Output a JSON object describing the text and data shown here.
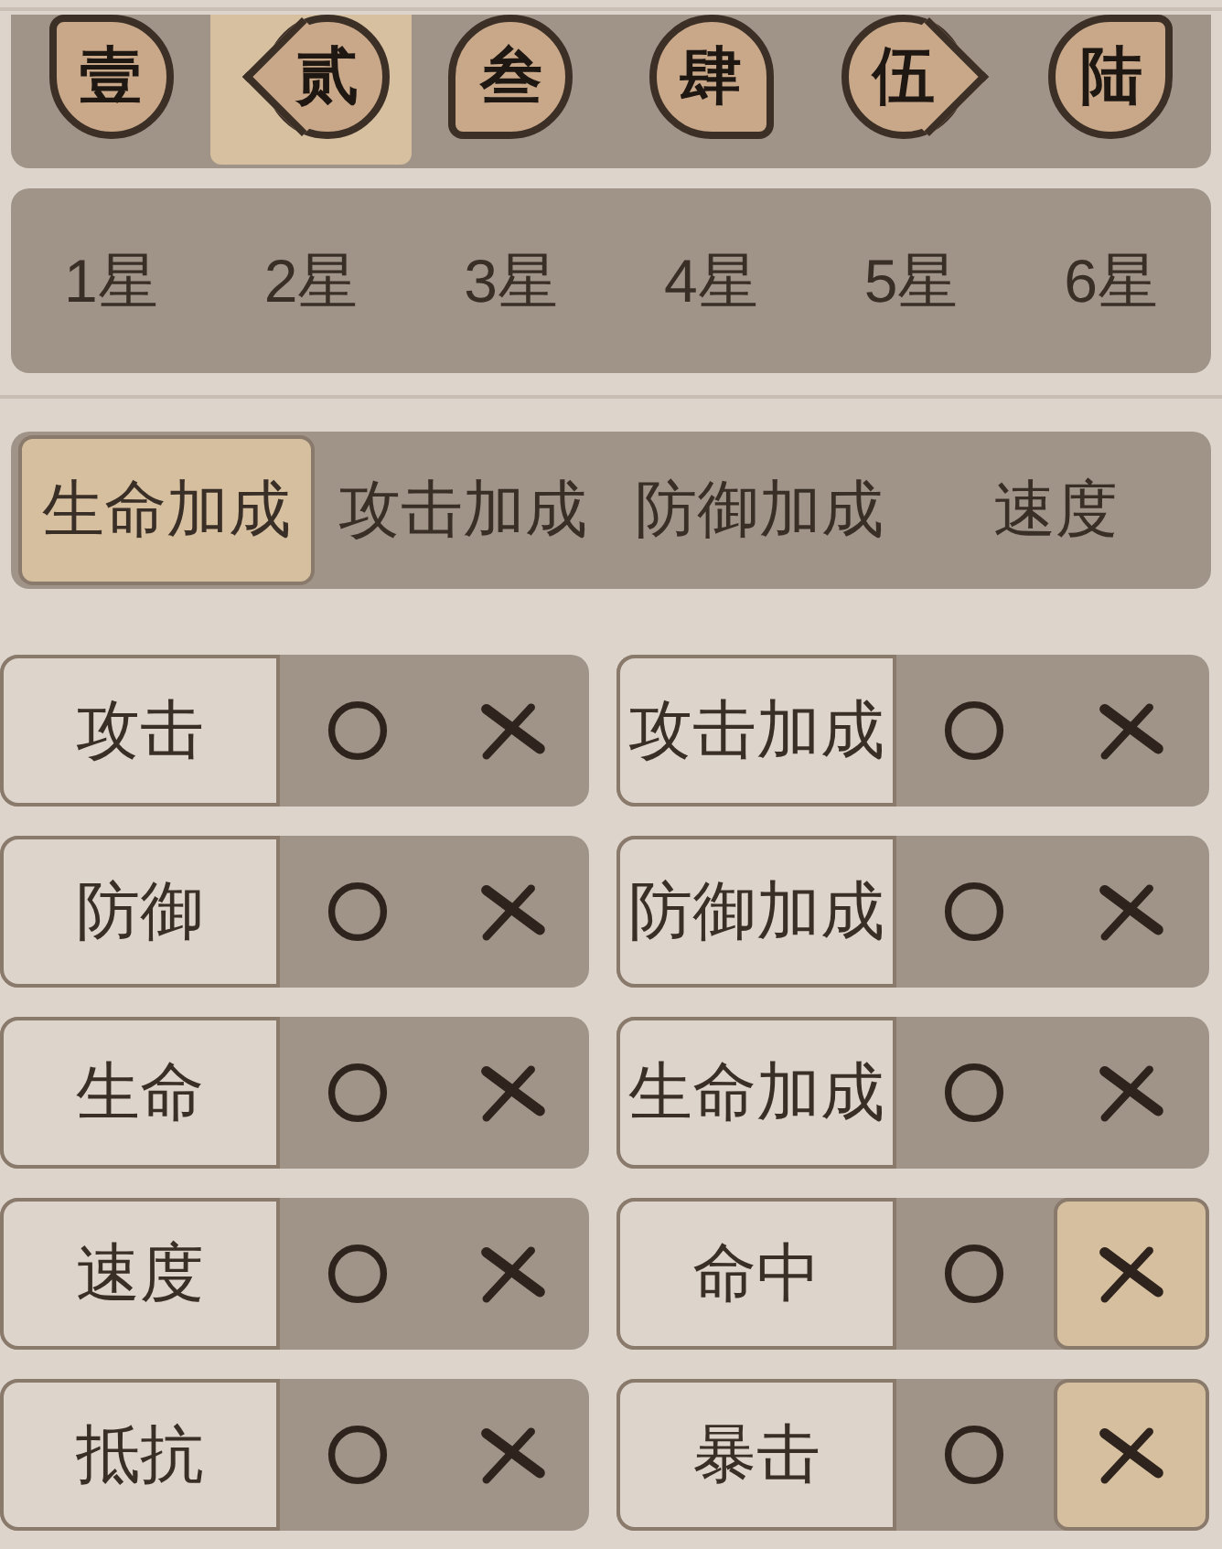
{
  "slots": [
    {
      "label": "壹",
      "kind": "corner-tl",
      "selected": false
    },
    {
      "label": "贰",
      "kind": "arrow-left",
      "selected": true
    },
    {
      "label": "叁",
      "kind": "corner-bl",
      "selected": false
    },
    {
      "label": "肆",
      "kind": "corner-br",
      "selected": false
    },
    {
      "label": "伍",
      "kind": "arrow-right",
      "selected": false
    },
    {
      "label": "陆",
      "kind": "corner-tr",
      "selected": false
    }
  ],
  "star_levels": [
    "1星",
    "2星",
    "3星",
    "4星",
    "5星",
    "6星"
  ],
  "tabs": [
    {
      "label": "生命加成",
      "selected": true
    },
    {
      "label": "攻击加成",
      "selected": false
    },
    {
      "label": "防御加成",
      "selected": false
    },
    {
      "label": "速度",
      "selected": false
    }
  ],
  "attribute_filters": [
    {
      "label": "攻击",
      "options": [
        {
          "kind": "include",
          "selected": false
        },
        {
          "kind": "exclude",
          "selected": false
        }
      ]
    },
    {
      "label": "攻击加成",
      "options": [
        {
          "kind": "include",
          "selected": false
        },
        {
          "kind": "exclude",
          "selected": false
        }
      ]
    },
    {
      "label": "防御",
      "options": [
        {
          "kind": "include",
          "selected": false
        },
        {
          "kind": "exclude",
          "selected": false
        }
      ]
    },
    {
      "label": "防御加成",
      "options": [
        {
          "kind": "include",
          "selected": false
        },
        {
          "kind": "exclude",
          "selected": false
        }
      ]
    },
    {
      "label": "生命",
      "options": [
        {
          "kind": "include",
          "selected": false
        },
        {
          "kind": "exclude",
          "selected": false
        }
      ]
    },
    {
      "label": "生命加成",
      "options": [
        {
          "kind": "include",
          "selected": false
        },
        {
          "kind": "exclude",
          "selected": false
        }
      ]
    },
    {
      "label": "速度",
      "options": [
        {
          "kind": "include",
          "selected": false
        },
        {
          "kind": "exclude",
          "selected": false
        }
      ]
    },
    {
      "label": "命中",
      "options": [
        {
          "kind": "include",
          "selected": false
        },
        {
          "kind": "exclude",
          "selected": true
        }
      ]
    },
    {
      "label": "抵抗",
      "options": [
        {
          "kind": "include",
          "selected": false
        },
        {
          "kind": "exclude",
          "selected": false
        }
      ]
    },
    {
      "label": "暴击",
      "options": [
        {
          "kind": "include",
          "selected": false
        },
        {
          "kind": "exclude",
          "selected": true
        }
      ]
    }
  ]
}
